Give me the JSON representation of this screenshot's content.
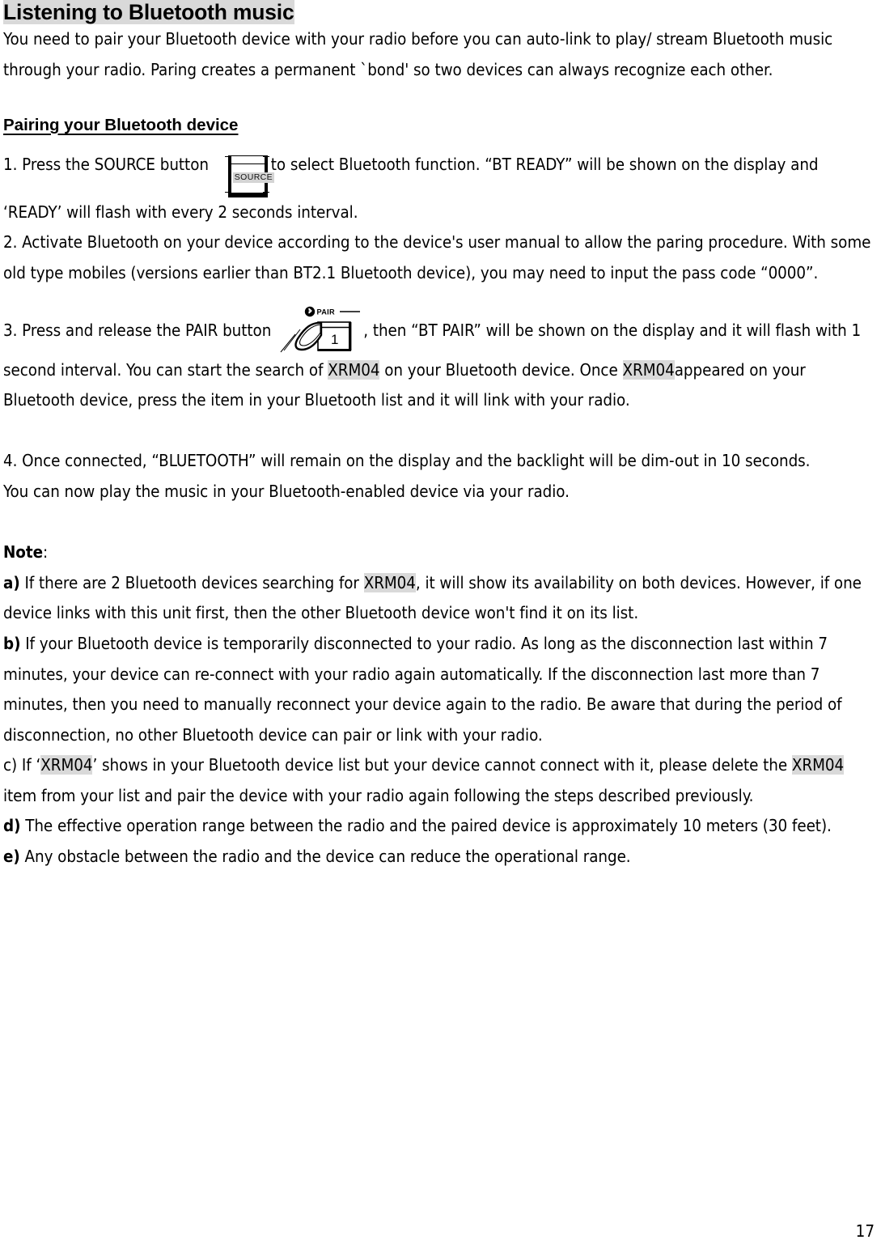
{
  "document": {
    "title": "Listening to Bluetooth music",
    "page_number": "17",
    "highlight_color": "#d9d9d9",
    "intro": "You need to pair your Bluetooth device with your radio before you can auto-link to play/ stream Bluetooth music through your radio. Paring creates a permanent `bond' so two devices can always recognize each other.",
    "section_heading": "Pairing your Bluetooth device",
    "steps": {
      "step1_before": "1. Press the SOURCE button ",
      "step1_after": "to select Bluetooth function. “BT READY” will be shown on the display and ‘READY’ will flash with every 2 seconds interval.",
      "step2": "2. Activate Bluetooth on your device according to the device's user manual to allow the paring procedure. With some old type mobiles (versions earlier than BT2.1 Bluetooth device), you may need to input the pass code “0000”.",
      "step3_before": "3. Press and release the PAIR button",
      "step3_mid1": ", then “BT PAIR” will be shown on the display and it will flash with 1 second interval. You can start the search of ",
      "step3_device1": "XRM04",
      "step3_mid2": " on your Bluetooth device. Once ",
      "step3_device2": "XRM04",
      "step3_after": "appeared on your Bluetooth device, press the item in your Bluetooth list and it will link with your radio.",
      "step4": "4. Once connected, “BLUETOOTH” will remain on the display and the backlight will be dim-out in 10 seconds.",
      "step4_extra": "You can now play the music in your Bluetooth-enabled device via your radio."
    },
    "figures": {
      "source_button": {
        "icon_name": "source-button-illustration",
        "label": "SOURCE"
      },
      "pair_button": {
        "icon_name": "pair-button-illustration",
        "label": "PAIR",
        "callout_number": "1",
        "bluetooth_icon": "bluetooth-icon"
      }
    },
    "note": {
      "label": "Note",
      "label_colon": ":",
      "items": [
        {
          "marker": "a)",
          "marker_bold": true,
          "text_before": " If there are 2 Bluetooth devices searching for ",
          "device": "XRM04",
          "text_after": ", it will show its availability on both devices. However, if one device links with this unit first, then the other Bluetooth device won't find it on its list."
        },
        {
          "marker": "b)",
          "marker_bold": true,
          "text_before": " If your Bluetooth device is temporarily disconnected to your radio. As long as the disconnection last within 7 minutes, your device can re-connect with your radio again automatically. If the disconnection last more than 7 minutes, then you need to manually reconnect your device again to the radio. Be aware that during the period of disconnection, no other Bluetooth device can pair or link with your radio.",
          "device": "",
          "text_after": ""
        },
        {
          "marker": "c)",
          "marker_bold": false,
          "text_before": " If ‘",
          "device": "XRM04",
          "text_mid": "’ shows in your Bluetooth device list but your device cannot connect with it, please delete the ",
          "device2": "XRM04",
          "text_after": " item from your list and pair the device with your radio again following the steps described previously."
        },
        {
          "marker": "d)",
          "marker_bold": true,
          "text_before": " The effective operation range between the radio and the paired device is approximately 10 meters (30 feet).",
          "device": "",
          "text_after": ""
        },
        {
          "marker": "e)",
          "marker_bold": true,
          "text_before": " Any obstacle between the radio and the device can reduce the operational range.",
          "device": "",
          "text_after": ""
        }
      ]
    }
  }
}
